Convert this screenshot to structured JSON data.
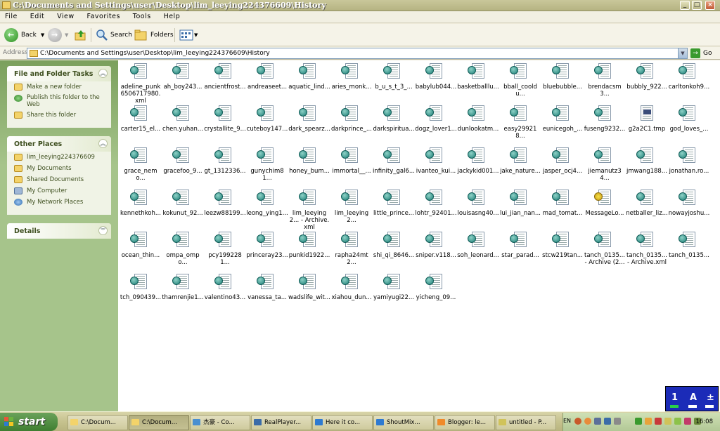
{
  "window": {
    "title": "C:\\Documents and Settings\\user\\Desktop\\lim_leeying224376609\\History"
  },
  "menu": [
    "File",
    "Edit",
    "View",
    "Favorites",
    "Tools",
    "Help"
  ],
  "toolbar": {
    "back": "Back",
    "search": "Search",
    "folders": "Folders"
  },
  "address": {
    "label": "Address",
    "value": "C:\\Documents and Settings\\user\\Desktop\\lim_leeying224376609\\History",
    "go": "Go"
  },
  "sidebar": {
    "tasks": {
      "title": "File and Folder Tasks",
      "items": [
        "Make a new folder",
        "Publish this folder to the Web",
        "Share this folder"
      ]
    },
    "places": {
      "title": "Other Places",
      "items": [
        "lim_leeying224376609",
        "My Documents",
        "Shared Documents",
        "My Computer",
        "My Network Places"
      ]
    },
    "details": {
      "title": "Details"
    }
  },
  "files": [
    "adeline_punk6506717980.xml",
    "ah_boy243...",
    "ancientfrost...",
    "andreaseet...",
    "aquatic_lind...",
    "aries_monk...",
    "b_u_s_t_3_...",
    "babylub044...",
    "basketballlu...",
    "bball_cooldu...",
    "bluebubble...",
    "brendacsm3...",
    "bubbly_922...",
    "carltonkoh9...",
    "carter15_el...",
    "chen.yuhan...",
    "crystallite_9...",
    "cuteboy147...",
    "dark_spearz...",
    "darkprince_...",
    "darkspiritua...",
    "dogz_lover1...",
    "dunlookatm...",
    "easy299218...",
    "eunicegoh_...",
    "fuseng9232...",
    "g2a2C1.tmp",
    "god_loves_...",
    "grace_nemo...",
    "gracefoo_9...",
    "gt_1312336...",
    "gunychim81...",
    "honey_bum...",
    "immortal__...",
    "infinity_gal6...",
    "ivanteo_kui...",
    "jackykid001...",
    "jake_nature...",
    "jasper_ocj4...",
    "jiemanutz34...",
    "jmwang188...",
    "jonathan.ro...",
    "kennethkoh...",
    "kokunut_92...",
    "leezw88199...",
    "leong_ying1...",
    "lim_leeying2... - Archive.xml",
    "lim_leeying2...",
    "little_prince...",
    "lohtr_92401...",
    "louisasng40...",
    "lui_jian_nan...",
    "mad_tomat...",
    "MessageLo...",
    "netballer_liz...",
    "nowayjoshu...",
    "ocean_thin...",
    "ompa_ompo...",
    "pcy1992281...",
    "princeray23...",
    "punkid1922...",
    "rapha24mt2...",
    "shi_qi_8646...",
    "sniper.v118...",
    "soh_leonard...",
    "star_parad...",
    "stcw219tan...",
    "tanch_0135... - Archive (2...",
    "tanch_0135... - Archive.xml",
    "tanch_0135...",
    "tch_090439...",
    "thamrenjie1...",
    "valentino43...",
    "vanessa_ta...",
    "wadslife_wit...",
    "xiahou_dun...",
    "yamiyugi22...",
    "yicheng_09..."
  ],
  "taskbar": {
    "start": "start",
    "tasks": [
      "C:\\Docum...",
      "C:\\Docum...",
      "杰豪 - Co...",
      "RealPlayer...",
      "Here it co...",
      "ShoutMix...",
      "Blogger: le...",
      "untitled - P..."
    ],
    "lang": "EN",
    "clock": "16:08"
  },
  "ime": {
    "a": "1",
    "b": "A",
    "c": "±"
  },
  "colors": {
    "accent": "#3f7e31",
    "sidebar": "#a6c48b",
    "ime": "#1b2bb8"
  }
}
